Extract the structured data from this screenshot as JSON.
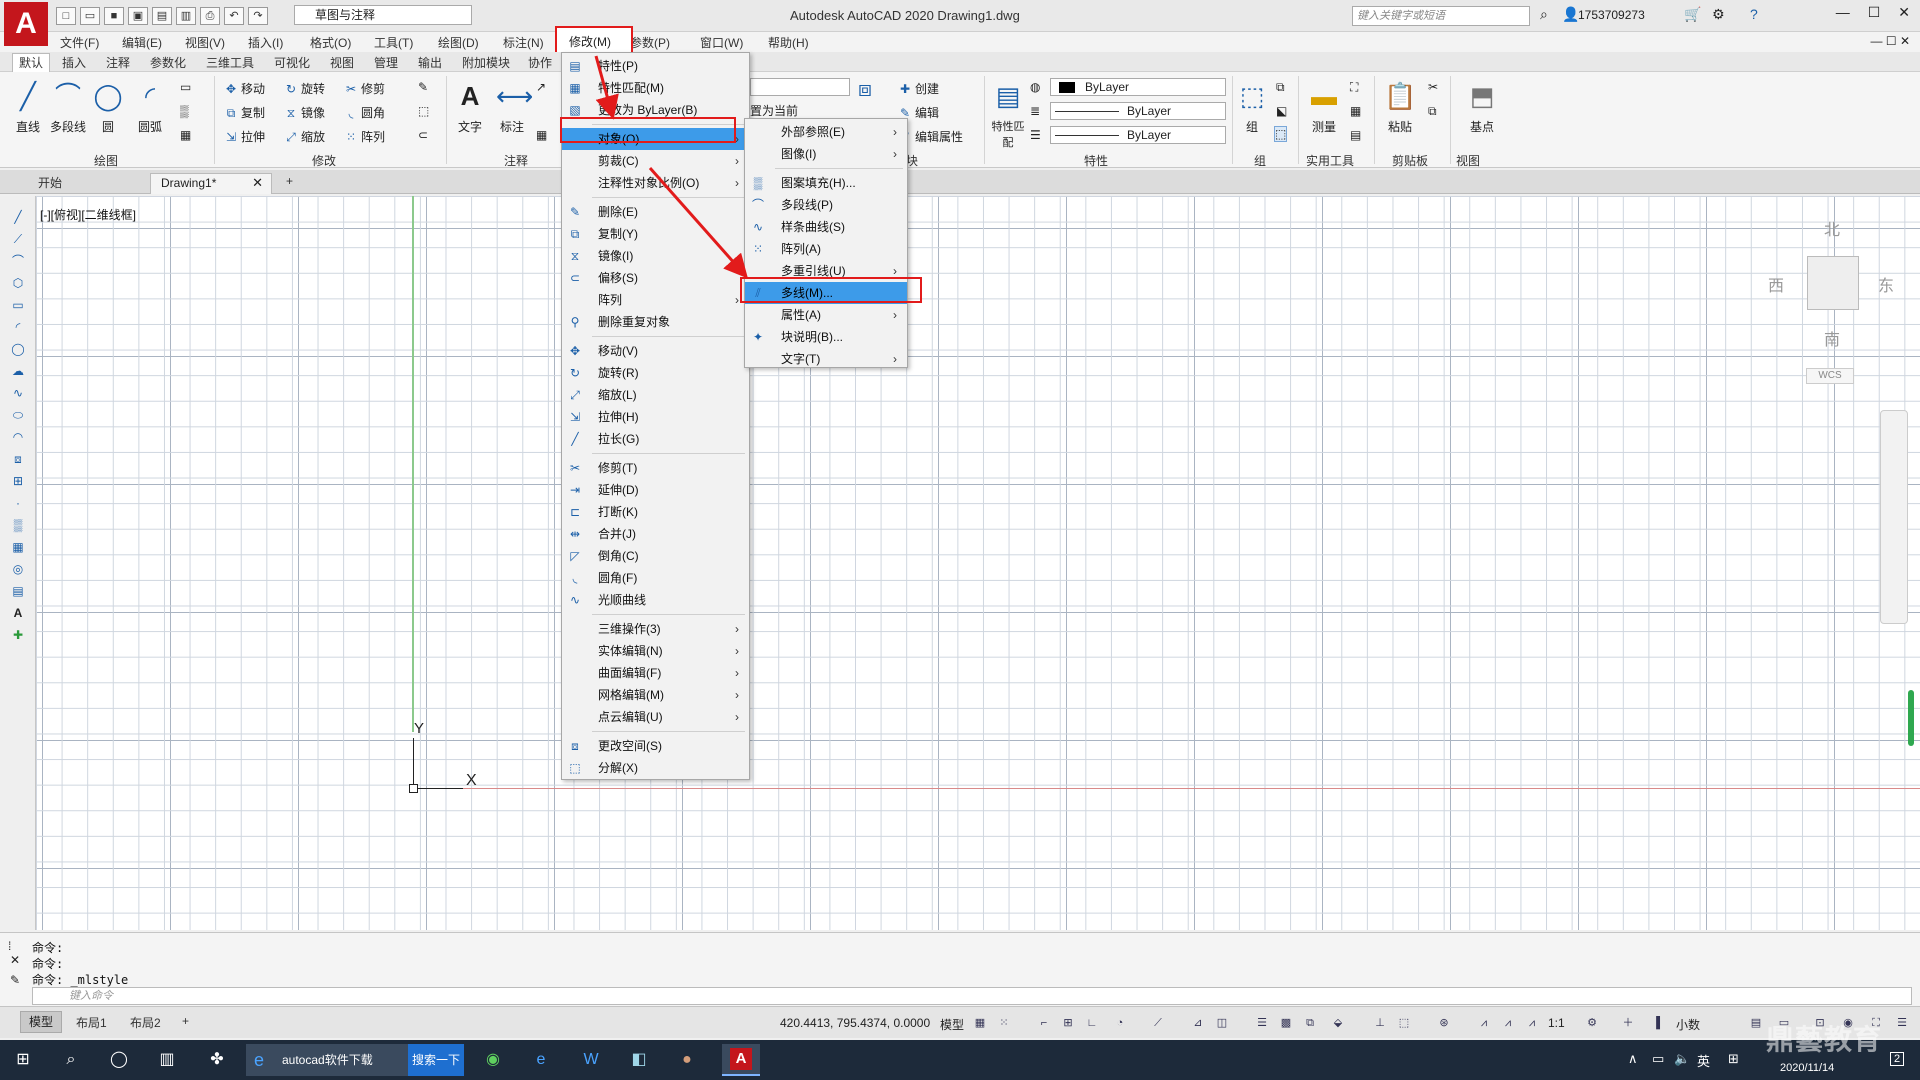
{
  "title_bar": {
    "logo_letter": "A",
    "workspace": "草图与注释",
    "window_title": "Autodesk AutoCAD 2020    Drawing1.dwg",
    "search_placeholder": "键入关键字或短语",
    "user": "1753709273"
  },
  "menu_bar": {
    "items": [
      "文件(F)",
      "编辑(E)",
      "视图(V)",
      "插入(I)",
      "格式(O)",
      "工具(T)",
      "绘图(D)",
      "标注(N)",
      "修改(M)",
      "参数(P)",
      "窗口(W)",
      "帮助(H)"
    ],
    "active": "修改(M)"
  },
  "ribbon_tabs": [
    "默认",
    "插入",
    "注释",
    "参数化",
    "三维工具",
    "可视化",
    "视图",
    "管理",
    "输出",
    "附加模块",
    "协作"
  ],
  "ribbon": {
    "draw_tools": [
      "直线",
      "多段线",
      "圆",
      "圆弧"
    ],
    "draw_panel": "绘图",
    "modify_small": [
      "移动",
      "旋转",
      "修剪",
      "复制",
      "镜像",
      "圆角",
      "拉伸",
      "缩放",
      "阵列"
    ],
    "modify_panel": "修改",
    "annot_tools": [
      "文字",
      "标注"
    ],
    "annot_panel": "注释",
    "layer_current": "置为当前",
    "block_small": [
      "创建",
      "编辑",
      "编辑属性"
    ],
    "block_panel": "块",
    "match_prop": "特性匹配",
    "props": [
      "ByLayer",
      "ByLayer",
      "ByLayer"
    ],
    "props_panel": "特性",
    "group_tool": "组",
    "group_panel": "组",
    "measure_tool": "测量",
    "utility_panel": "实用工具",
    "paste_tool": "粘贴",
    "clipboard_panel": "剪贴板",
    "base_tool": "基点",
    "view_panel": "视图"
  },
  "file_tabs": {
    "start": "开始",
    "drawing": "Drawing1*",
    "add": "+"
  },
  "canvas": {
    "view_label": "[-][俯视][二维线框]",
    "axis_x": "X",
    "axis_y": "Y",
    "compass": {
      "north": "北",
      "south": "南",
      "east": "东",
      "west": "西"
    },
    "wcs": "WCS"
  },
  "modify_menu": {
    "items": [
      {
        "label": "特性(P)",
        "icon": "properties-icon"
      },
      {
        "label": "特性匹配(M)",
        "icon": "match-properties-icon"
      },
      {
        "label": "更改为 ByLayer(B)",
        "icon": "bylayer-icon"
      },
      {
        "label": "对象(O)",
        "icon": "",
        "submenu": true,
        "highlighted": true
      },
      {
        "label": "剪裁(C)",
        "icon": "",
        "submenu": true
      },
      {
        "label": "注释性对象比例(O)",
        "icon": "",
        "submenu": true
      },
      {
        "label": "删除(E)",
        "icon": "erase-icon"
      },
      {
        "label": "复制(Y)",
        "icon": "copy-icon"
      },
      {
        "label": "镜像(I)",
        "icon": "mirror-icon"
      },
      {
        "label": "偏移(S)",
        "icon": "offset-icon"
      },
      {
        "label": "阵列",
        "icon": "",
        "submenu": true
      },
      {
        "label": "删除重复对象",
        "icon": "overkill-icon"
      },
      {
        "label": "移动(V)",
        "icon": "move-icon"
      },
      {
        "label": "旋转(R)",
        "icon": "rotate-icon"
      },
      {
        "label": "缩放(L)",
        "icon": "scale-icon"
      },
      {
        "label": "拉伸(H)",
        "icon": "stretch-icon"
      },
      {
        "label": "拉长(G)",
        "icon": "lengthen-icon"
      },
      {
        "label": "修剪(T)",
        "icon": "trim-icon"
      },
      {
        "label": "延伸(D)",
        "icon": "extend-icon"
      },
      {
        "label": "打断(K)",
        "icon": "break-icon"
      },
      {
        "label": "合并(J)",
        "icon": "join-icon"
      },
      {
        "label": "倒角(C)",
        "icon": "chamfer-icon"
      },
      {
        "label": "圆角(F)",
        "icon": "fillet-icon"
      },
      {
        "label": "光顺曲线",
        "icon": "blend-icon"
      },
      {
        "label": "三维操作(3)",
        "icon": "",
        "submenu": true
      },
      {
        "label": "实体编辑(N)",
        "icon": "",
        "submenu": true
      },
      {
        "label": "曲面编辑(F)",
        "icon": "",
        "submenu": true
      },
      {
        "label": "网格编辑(M)",
        "icon": "",
        "submenu": true
      },
      {
        "label": "点云编辑(U)",
        "icon": "",
        "submenu": true
      },
      {
        "label": "更改空间(S)",
        "icon": "change-space-icon"
      },
      {
        "label": "分解(X)",
        "icon": "explode-icon"
      }
    ]
  },
  "object_submenu": {
    "items": [
      {
        "label": "外部参照(E)",
        "submenu": true
      },
      {
        "label": "图像(I)",
        "submenu": true
      },
      {
        "label": "图案填充(H)...",
        "icon": "hatch-icon"
      },
      {
        "label": "多段线(P)",
        "icon": "polyline-icon"
      },
      {
        "label": "样条曲线(S)",
        "icon": "spline-icon"
      },
      {
        "label": "阵列(A)",
        "icon": "array-icon"
      },
      {
        "label": "多重引线(U)",
        "submenu": true
      },
      {
        "label": "多线(M)...",
        "icon": "mline-icon",
        "highlighted": true
      },
      {
        "label": "属性(A)",
        "submenu": true
      },
      {
        "label": "块说明(B)...",
        "icon": "block-desc-icon"
      },
      {
        "label": "文字(T)",
        "submenu": true
      }
    ]
  },
  "command_window": {
    "lines": [
      "命令:",
      "命令:",
      "命令: _mlstyle"
    ],
    "placeholder": "键入命令"
  },
  "status_bar": {
    "tabs": [
      "模型",
      "布局1",
      "布局2"
    ],
    "add": "+",
    "coords": "420.4413, 795.4374, 0.0000",
    "model": "模型",
    "scale": "1:1",
    "units": "小数"
  },
  "taskbar": {
    "ie_task": "autocad软件下载",
    "search_btn": "搜索一下",
    "lang": "英",
    "date": "2020/11/14",
    "notification_count": "2"
  },
  "watermark": "鼎藝教育",
  "colors": {
    "highlight": "#3d9be9",
    "annotation_red": "#e21b1b",
    "autocad_red": "#c4161c"
  }
}
